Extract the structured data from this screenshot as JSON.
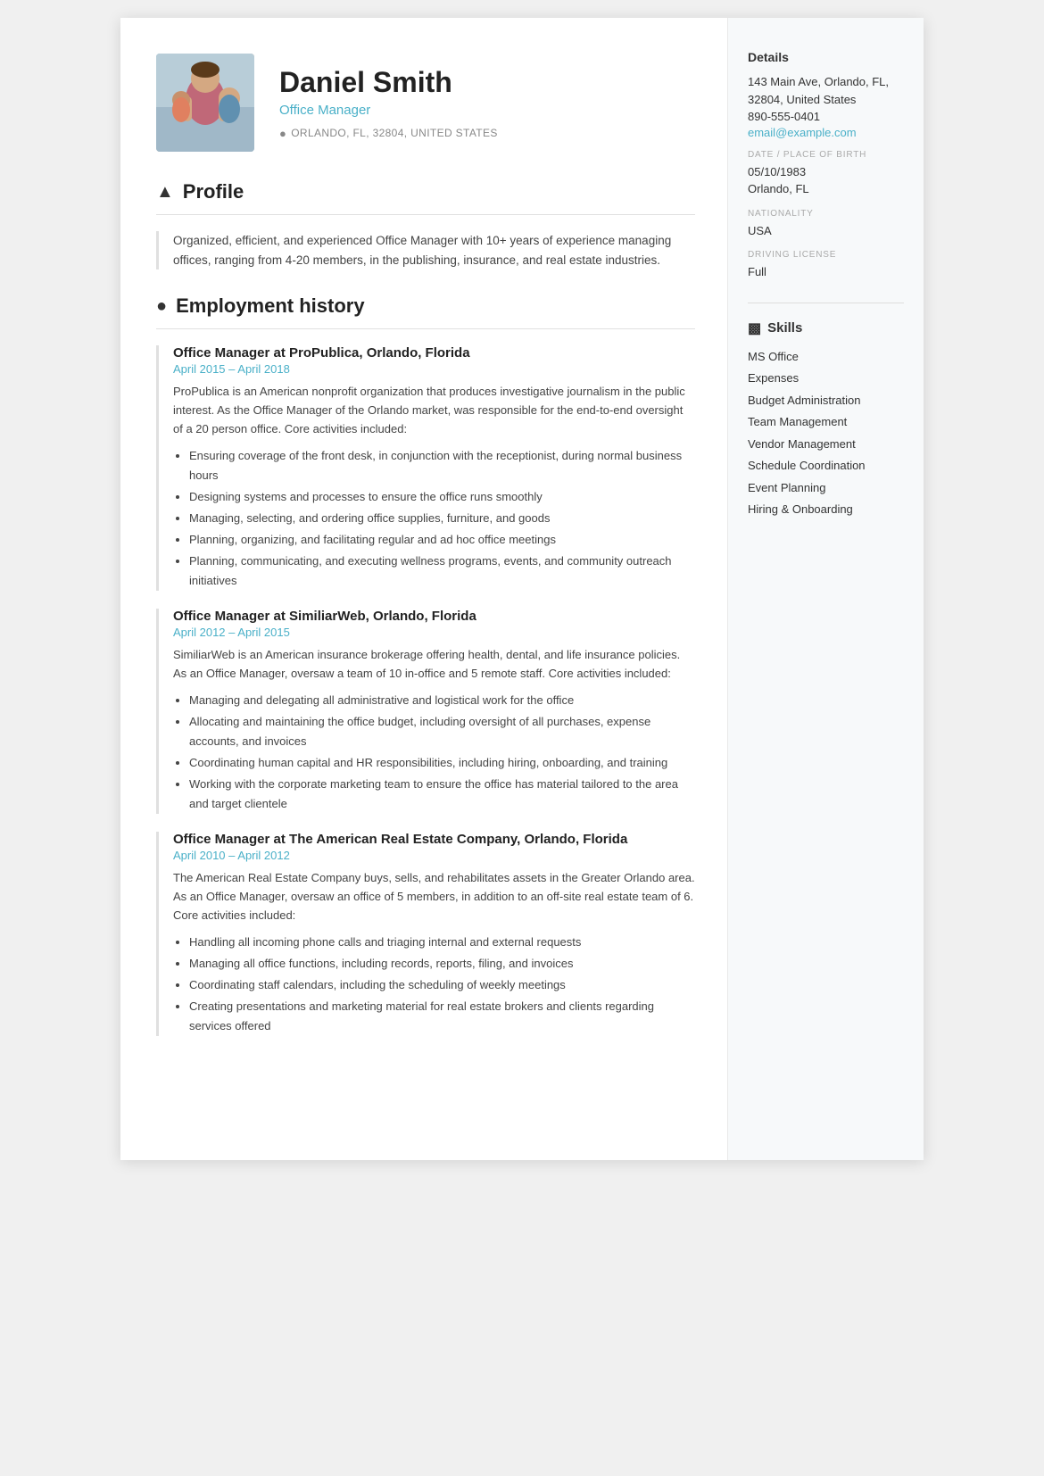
{
  "header": {
    "name": "Daniel Smith",
    "title": "Office Manager",
    "location": "ORLANDO, FL, 32804, UNITED STATES"
  },
  "sidebar": {
    "details_title": "Details",
    "address": "143 Main Ave, Orlando, FL, 32804, United States",
    "phone": "890-555-0401",
    "email": "email@example.com",
    "dob_label": "DATE / PLACE OF BIRTH",
    "dob": "05/10/1983",
    "dob_place": "Orlando, FL",
    "nationality_label": "NATIONALITY",
    "nationality": "USA",
    "driving_label": "DRIVING LICENSE",
    "driving": "Full",
    "skills_title": "Skills",
    "skills": [
      "MS Office",
      "Expenses",
      "Budget Administration",
      "Team Management",
      "Vendor Management",
      "Schedule Coordination",
      "Event Planning",
      "Hiring & Onboarding"
    ]
  },
  "profile": {
    "section_title": "Profile",
    "text": "Organized, efficient, and experienced Office Manager with 10+ years of experience managing offices, ranging from 4-20 members, in the publishing, insurance, and real estate industries."
  },
  "employment": {
    "section_title": "Employment history",
    "jobs": [
      {
        "title": "Office Manager at ProPublica, Orlando, Florida",
        "date": "April 2015  –  April 2018",
        "description": "ProPublica is an American nonprofit organization that produces investigative journalism in the public interest. As the Office Manager of the Orlando market, was responsible for the end-to-end oversight of a 20 person office. Core activities included:",
        "bullets": [
          "Ensuring coverage of the front desk, in conjunction with the receptionist, during normal business hours",
          "Designing systems and processes to ensure the office runs smoothly",
          "Managing, selecting, and ordering office supplies, furniture, and goods",
          "Planning, organizing, and facilitating regular and ad hoc office meetings",
          "Planning, communicating, and executing wellness programs, events, and community outreach initiatives"
        ]
      },
      {
        "title": "Office Manager at SimiliarWeb, Orlando, Florida",
        "date": "April 2012  –  April 2015",
        "description": "SimiliarWeb is an American insurance brokerage offering health, dental, and life insurance policies. As an Office Manager, oversaw a team of 10 in-office and 5 remote staff. Core activities included:",
        "bullets": [
          "Managing and delegating all administrative and logistical work for the office",
          "Allocating and maintaining the office budget, including oversight of all purchases, expense accounts, and invoices",
          "Coordinating human capital and HR responsibilities, including hiring, onboarding, and training",
          "Working with the corporate marketing team to ensure the office has material tailored to the area and target clientele"
        ]
      },
      {
        "title": "Office Manager at The American Real Estate Company, Orlando, Florida",
        "date": "April 2010  –  April 2012",
        "description": "The American Real Estate Company buys, sells, and rehabilitates assets in the Greater Orlando area. As an Office Manager, oversaw an office of 5 members, in addition to an off-site real estate team of 6. Core activities included:",
        "bullets": [
          "Handling all incoming phone calls and triaging internal and external requests",
          "Managing all office functions, including records, reports, filing, and invoices",
          "Coordinating staff calendars, including the scheduling of weekly meetings",
          "Creating presentations and marketing material for real estate brokers and clients regarding services offered"
        ]
      }
    ]
  }
}
